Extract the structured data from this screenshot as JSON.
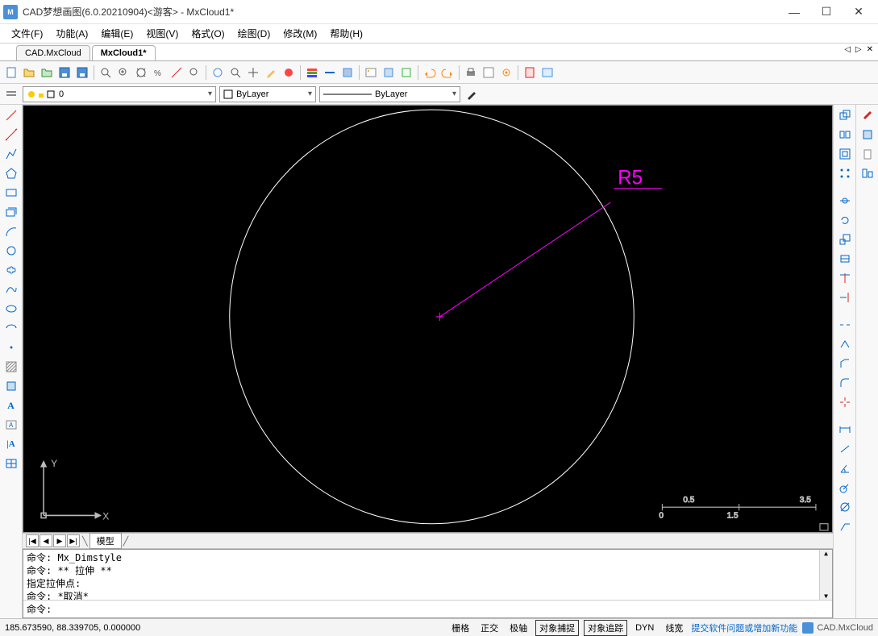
{
  "window": {
    "title": "CAD梦想画图(6.0.20210904)<游客> - MxCloud1*",
    "min": "—",
    "max": "☐",
    "close": "✕"
  },
  "menu": {
    "file": "文件(F)",
    "function": "功能(A)",
    "edit": "编辑(E)",
    "view": "视图(V)",
    "format": "格式(O)",
    "draw": "绘图(D)",
    "modify": "修改(M)",
    "help": "帮助(H)"
  },
  "doc_tabs": {
    "tab1": "CAD.MxCloud",
    "tab2": "MxCloud1*"
  },
  "layer": {
    "name": "0",
    "color_label": "ByLayer",
    "linetype_label": "ByLayer"
  },
  "canvas": {
    "dim_label": "R5",
    "scale_ticks": {
      "t1": "0.5",
      "t2": "3.5",
      "b1": "0",
      "b2": "1.5"
    },
    "axis": {
      "x": "X",
      "y": "Y"
    }
  },
  "bottom": {
    "model_tab": "模型"
  },
  "cmd": {
    "l1": "命令: Mx_Dimstyle",
    "l2": "命令: ** 拉伸 **",
    "l3": "指定拉伸点:",
    "l4": "命令: *取消*",
    "prompt": "命令:"
  },
  "status": {
    "coords": "185.673590, 88.339705, 0.000000",
    "snap_grid": "栅格",
    "ortho": "正交",
    "polar": "极轴",
    "osnap": "对象捕捉",
    "otrack": "对象追踪",
    "dyn": "DYN",
    "lwt": "线宽",
    "feedback": "提交软件问题或增加新功能",
    "brand": "CAD.MxCloud"
  }
}
